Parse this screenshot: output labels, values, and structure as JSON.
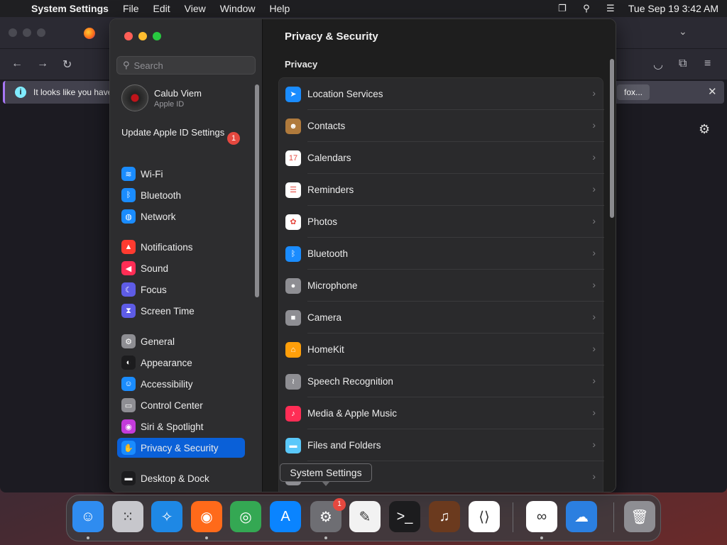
{
  "menubar": {
    "app_name": "System Settings",
    "items": [
      "File",
      "Edit",
      "View",
      "Window",
      "Help"
    ],
    "clock": "Tue Sep 19  3:42 AM"
  },
  "browser": {
    "notice_text": "It looks like you have",
    "notice_button": "fox..."
  },
  "settings": {
    "search_placeholder": "Search",
    "account": {
      "name": "Calub Viem",
      "subtitle": "Apple ID"
    },
    "update": {
      "label": "Update Apple ID Settings",
      "badge": "1"
    },
    "sidebar": [
      {
        "label": "Wi-Fi",
        "icon": "wifi-icon",
        "color": "#1a8cff",
        "glyph": "≋"
      },
      {
        "label": "Bluetooth",
        "icon": "bluetooth-icon",
        "color": "#1a8cff",
        "glyph": "ᛒ"
      },
      {
        "label": "Network",
        "icon": "globe-icon",
        "color": "#1a8cff",
        "glyph": "◍"
      },
      {
        "label": "Notifications",
        "icon": "bell-icon",
        "color": "#ff3b30",
        "glyph": "▲"
      },
      {
        "label": "Sound",
        "icon": "speaker-icon",
        "color": "#ff2d55",
        "glyph": "◀"
      },
      {
        "label": "Focus",
        "icon": "moon-icon",
        "color": "#5e5ce6",
        "glyph": "☾"
      },
      {
        "label": "Screen Time",
        "icon": "hourglass-icon",
        "color": "#5e5ce6",
        "glyph": "⧗"
      },
      {
        "label": "General",
        "icon": "gear-icon",
        "color": "#8e8e93",
        "glyph": "⚙"
      },
      {
        "label": "Appearance",
        "icon": "appearance-icon",
        "color": "#1c1c1e",
        "glyph": "◐"
      },
      {
        "label": "Accessibility",
        "icon": "accessibility-icon",
        "color": "#1a8cff",
        "glyph": "☺"
      },
      {
        "label": "Control Center",
        "icon": "control-center-icon",
        "color": "#8e8e93",
        "glyph": "▭"
      },
      {
        "label": "Siri & Spotlight",
        "icon": "siri-icon",
        "color": "#c43bdb",
        "glyph": "◉"
      },
      {
        "label": "Privacy & Security",
        "icon": "hand-icon",
        "color": "#1a8cff",
        "glyph": "✋"
      },
      {
        "label": "Desktop & Dock",
        "icon": "dock-icon",
        "color": "#1c1c1e",
        "glyph": "▬"
      }
    ],
    "selected": "Privacy & Security",
    "main": {
      "title": "Privacy & Security",
      "section": "Privacy",
      "rows": [
        {
          "label": "Location Services",
          "icon": "location-arrow-icon",
          "color": "#1a8cff",
          "glyph": "➤"
        },
        {
          "label": "Contacts",
          "icon": "contacts-icon",
          "color": "#b07a3c",
          "glyph": "☻"
        },
        {
          "label": "Calendars",
          "icon": "calendar-icon",
          "color": "#ffffff",
          "glyph": "17"
        },
        {
          "label": "Reminders",
          "icon": "reminders-icon",
          "color": "#ffffff",
          "glyph": "☰"
        },
        {
          "label": "Photos",
          "icon": "photos-icon",
          "color": "#ffffff",
          "glyph": "✿"
        },
        {
          "label": "Bluetooth",
          "icon": "bluetooth-icon",
          "color": "#1a8cff",
          "glyph": "ᛒ"
        },
        {
          "label": "Microphone",
          "icon": "microphone-icon",
          "color": "#8e8e93",
          "glyph": "●"
        },
        {
          "label": "Camera",
          "icon": "camera-icon",
          "color": "#8e8e93",
          "glyph": "■"
        },
        {
          "label": "HomeKit",
          "icon": "home-icon",
          "color": "#ff9f0a",
          "glyph": "⌂"
        },
        {
          "label": "Speech Recognition",
          "icon": "waveform-icon",
          "color": "#8e8e93",
          "glyph": "≀"
        },
        {
          "label": "Media & Apple Music",
          "icon": "music-icon",
          "color": "#ff2d55",
          "glyph": "♪"
        },
        {
          "label": "Files and Folders",
          "icon": "folder-icon",
          "color": "#5ac8fa",
          "glyph": "▬"
        },
        {
          "label": "s",
          "icon": "row-icon",
          "color": "#8e8e93",
          "glyph": ""
        }
      ]
    }
  },
  "tooltip": "System Settings",
  "dock": [
    {
      "name": "finder",
      "icon": "finder-icon",
      "color": "#2f8cf0",
      "glyph": "☺",
      "running": true
    },
    {
      "name": "launchpad",
      "icon": "launchpad-icon",
      "color": "#c7c7cc",
      "glyph": "⁙",
      "running": false
    },
    {
      "name": "safari",
      "icon": "safari-icon",
      "color": "#1e88e5",
      "glyph": "✧",
      "running": false
    },
    {
      "name": "firefox",
      "icon": "firefox-icon",
      "color": "#ff6a1a",
      "glyph": "◉",
      "running": true
    },
    {
      "name": "chrome",
      "icon": "chrome-icon",
      "color": "#34a853",
      "glyph": "◎",
      "running": false
    },
    {
      "name": "app-store",
      "icon": "app-store-icon",
      "color": "#0a84ff",
      "glyph": "A",
      "running": false
    },
    {
      "name": "system-settings",
      "icon": "system-settings-icon",
      "color": "#6e6e73",
      "glyph": "⚙",
      "running": true,
      "badge": "1"
    },
    {
      "name": "textedit",
      "icon": "textedit-icon",
      "color": "#f2f2f2",
      "glyph": "✎",
      "running": false
    },
    {
      "name": "terminal",
      "icon": "terminal-icon",
      "color": "#1c1c1e",
      "glyph": ">_",
      "running": false
    },
    {
      "name": "garageband",
      "icon": "garageband-icon",
      "color": "#6b3a1e",
      "glyph": "♫",
      "running": false
    },
    {
      "name": "vscode",
      "icon": "vscode-icon",
      "color": "#ffffff",
      "glyph": "⟨⟩",
      "running": false
    },
    {
      "name": "visual-studio",
      "icon": "visual-studio-icon",
      "color": "#ffffff",
      "glyph": "∞",
      "running": true
    },
    {
      "name": "weather",
      "icon": "weather-icon",
      "color": "#2b7fe0",
      "glyph": "☁",
      "running": false
    },
    {
      "name": "trash",
      "icon": "trash-icon",
      "color": "#8e8e93",
      "glyph": "🗑",
      "running": false
    }
  ]
}
